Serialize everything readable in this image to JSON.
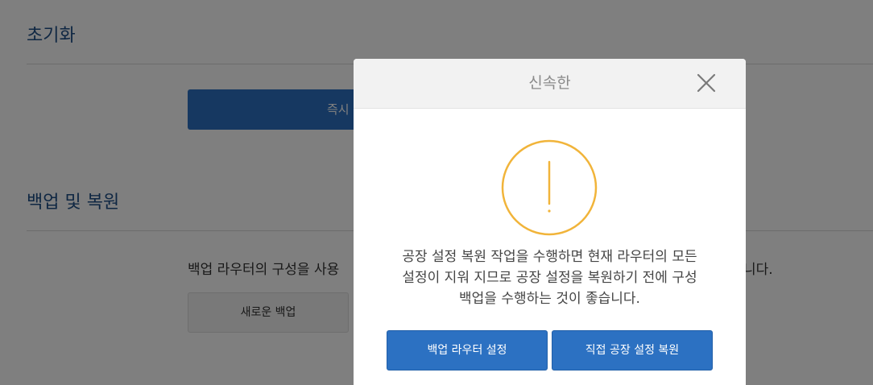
{
  "background": {
    "reset_section": {
      "title": "초기화",
      "button_label": "즉시"
    },
    "backup_section": {
      "title": "백업 및 복원",
      "description": "백업 라우터의 구성을 사용",
      "description_tail": "니다.",
      "new_backup_label": "새로운 백업"
    }
  },
  "modal": {
    "title": "신속한",
    "message_lines": [
      "공장 설정 복원 작업을 수행하면 현재 라우터의 모든",
      "설정이 지워 지므로 공장 설정을 복원하기 전에 구성",
      "백업을 수행하는 것이 좋습니다."
    ],
    "buttons": {
      "backup_label": "백업 라우터 설정",
      "restore_label": "직접 공장 설정 복원"
    },
    "icons": {
      "close": "close-icon",
      "warning": "warning-icon"
    }
  },
  "colors": {
    "primary": "#2c71c2",
    "section_title": "#1f4f86",
    "warning": "#f1b43a",
    "overlay": "rgba(0,0,0,0.5)"
  }
}
